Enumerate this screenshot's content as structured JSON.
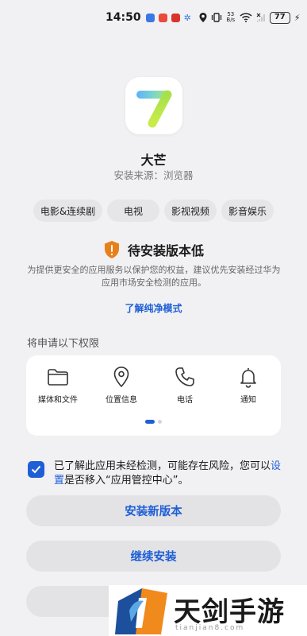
{
  "status_bar": {
    "time": "14:50",
    "net_speed_top": "53",
    "net_speed_bottom": "B/s",
    "battery": "77"
  },
  "app": {
    "name": "大芒",
    "source": "安装来源：浏览器"
  },
  "tags": [
    "电影&连续剧",
    "电视",
    "影视视频",
    "影音娱乐"
  ],
  "warning": {
    "title": "待安装版本低",
    "description": "为提供更安全的应用服务以保护您的权益，建议优先安装经过华为应用市场安全检测的应用。",
    "link": "了解纯净模式",
    "color": "#e8801a"
  },
  "permissions": {
    "title": "将申请以下权限",
    "items": [
      {
        "label": "媒体和文件",
        "icon": "folder-icon"
      },
      {
        "label": "位置信息",
        "icon": "location-pin-icon"
      },
      {
        "label": "电话",
        "icon": "phone-icon"
      },
      {
        "label": "通知",
        "icon": "bell-icon"
      }
    ]
  },
  "consent": {
    "checked": true,
    "text_before": "已了解此应用未经检测，可能存在风险，您可以",
    "link": "设置",
    "text_after": "是否移入“应用管控中心”。"
  },
  "buttons": {
    "install_new": "安装新版本",
    "continue": "继续安装"
  },
  "watermark": {
    "text": "天剑手游网",
    "sub": "tianjian8.com"
  },
  "colors": {
    "accent": "#1f5fd6",
    "background": "#f1f1f3"
  }
}
